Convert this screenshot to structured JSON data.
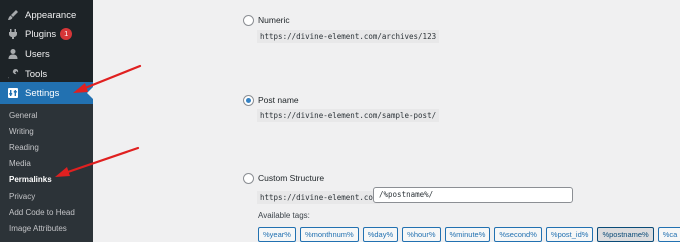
{
  "sidebar": {
    "menu": [
      {
        "label": "Appearance",
        "icon": "paintbrush-icon"
      },
      {
        "label": "Plugins",
        "icon": "plugin-icon",
        "badge": "1"
      },
      {
        "label": "Users",
        "icon": "user-icon"
      },
      {
        "label": "Tools",
        "icon": "wrench-icon"
      },
      {
        "label": "Settings",
        "icon": "settings-icon"
      }
    ],
    "submenu": [
      "General",
      "Writing",
      "Reading",
      "Media",
      "Permalinks",
      "Privacy",
      "Add Code to Head",
      "Image Attributes"
    ]
  },
  "permalinks": {
    "options": [
      {
        "label": "Numeric",
        "example": "https://divine-element.com/archives/123",
        "checked": false
      },
      {
        "label": "Post name",
        "example": "https://divine-element.com/sample-post/",
        "checked": true
      },
      {
        "label": "Custom Structure",
        "prefix": "https://divine-element.com",
        "value": "/%postname%/",
        "checked": false
      }
    ],
    "available_tags_label": "Available tags:",
    "tags": [
      "%year%",
      "%monthnum%",
      "%day%",
      "%hour%",
      "%minute%",
      "%second%",
      "%post_id%",
      "%postname%",
      "%ca"
    ]
  },
  "colors": {
    "sidebar_bg": "#1d2327",
    "submenu_bg": "#2c3338",
    "accent": "#2271b1",
    "badge": "#d63638",
    "annotation_arrow": "#e02020"
  }
}
